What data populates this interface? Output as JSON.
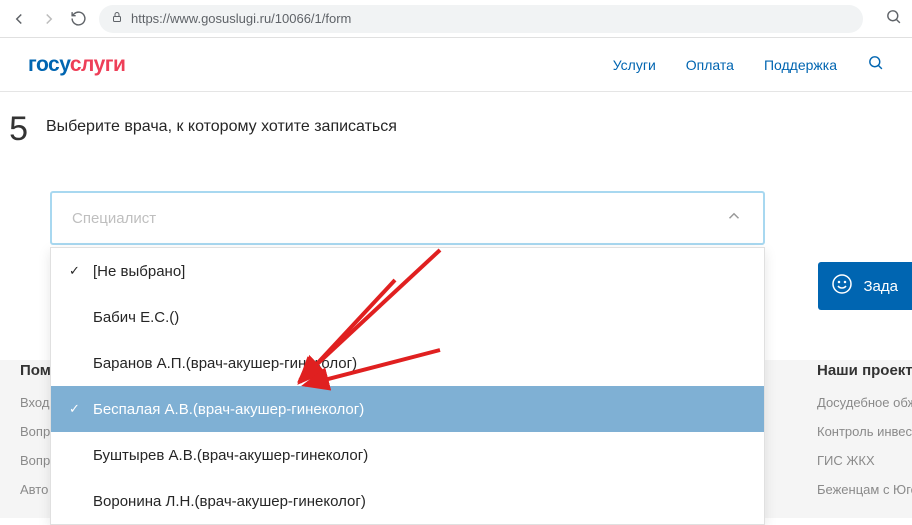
{
  "url": "https://www.gosuslugi.ru/10066/1/form",
  "logo": {
    "part1": "госу",
    "part2": "слуги"
  },
  "nav": {
    "services": "Услуги",
    "payment": "Оплата",
    "support": "Поддержка"
  },
  "step": {
    "number": "5",
    "title": "Выберите врача, к которому хотите записаться"
  },
  "select": {
    "placeholder": "Специалист"
  },
  "options": {
    "0": "[Не выбрано]",
    "1": "Бабич Е.С.()",
    "2": "Баранов А.П.(врач-акушер-гинеколог)",
    "3": "Беспалая А.В.(врач-акушер-гинеколог)",
    "4": "Буштырев А.В.(врач-акушер-гинеколог)",
    "5": "Воронина Л.Н.(врач-акушер-гинеколог)"
  },
  "chat": {
    "label": "Зада"
  },
  "footerLeft": {
    "title": "Пом",
    "l1": "Вход",
    "l2": "Вопр",
    "l3": "Вопр",
    "l4": "Авто"
  },
  "footerRight": {
    "title": "Наши проекты",
    "l1": "Досудебное обжал",
    "l2": "Контроль инвестиц",
    "l3": "ГИС ЖКХ",
    "l4": "Беженцам с Юго-В"
  }
}
